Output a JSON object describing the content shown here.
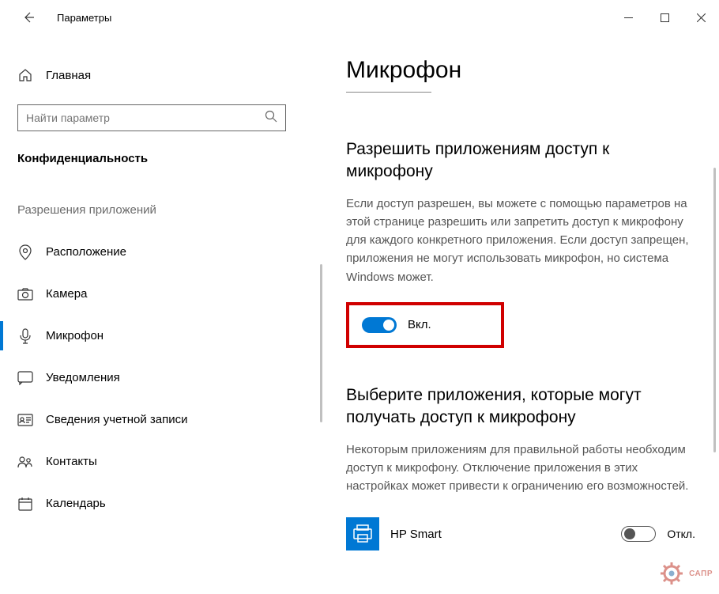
{
  "window": {
    "title": "Параметры"
  },
  "sidebar": {
    "home_label": "Главная",
    "search_placeholder": "Найти параметр",
    "section": "Конфиденциальность",
    "subsection": "Разрешения приложений",
    "items": [
      {
        "label": "Расположение"
      },
      {
        "label": "Камера"
      },
      {
        "label": "Микрофон"
      },
      {
        "label": "Уведомления"
      },
      {
        "label": "Сведения учетной записи"
      },
      {
        "label": "Контакты"
      },
      {
        "label": "Календарь"
      }
    ]
  },
  "main": {
    "title": "Микрофон",
    "section1": {
      "heading": "Разрешить приложениям доступ к микрофону",
      "body": "Если доступ разрешен, вы можете с помощью параметров на этой странице разрешить или запретить доступ к микрофону для каждого конкретного приложения. Если доступ запрещен, приложения не могут использовать микрофон, но система Windows может.",
      "toggle_label": "Вкл."
    },
    "section2": {
      "heading": "Выберите приложения, которые могут получать доступ к микрофону",
      "body": "Некоторым приложениям для правильной работы необходим доступ к микрофону. Отключение приложения в этих настройках может привести к ограничению его возможностей."
    },
    "app": {
      "name": "HP Smart",
      "toggle_label": "Откл."
    }
  },
  "watermark": "САПР"
}
